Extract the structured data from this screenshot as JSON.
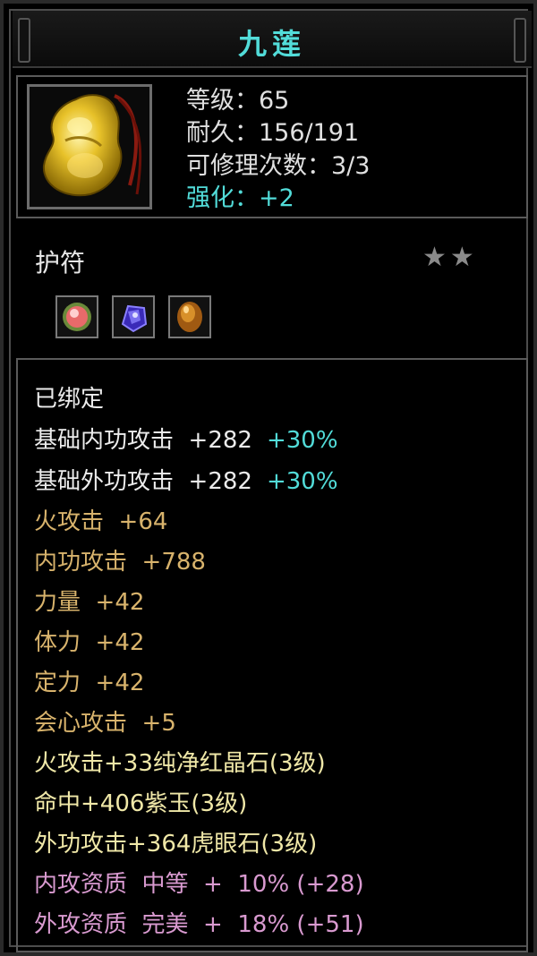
{
  "item": {
    "name": "九莲",
    "icon": "jade-pendant-icon",
    "stats": {
      "level": "等级：65",
      "durability": "耐久：156/191",
      "repairs": "可修理次数：3/3",
      "enhance": "强化：+2"
    },
    "type": "护符",
    "stars": "★★",
    "star_count": 2,
    "sockets": [
      {
        "icon": "red-crystal-gem-icon"
      },
      {
        "icon": "purple-jade-gem-icon"
      },
      {
        "icon": "tiger-eye-gem-icon"
      }
    ]
  },
  "attributes": {
    "bound": "已绑定",
    "base_inner_attack": {
      "label": "基础内功攻击  +282",
      "bonus": "+30%"
    },
    "base_outer_attack": {
      "label": "基础外功攻击  +282",
      "bonus": "+30%"
    },
    "fire_attack": "火攻击  +64",
    "inner_attack": "内功攻击  +788",
    "strength": "力量  +42",
    "constitution": "体力  +42",
    "focus": "定力  +42",
    "critical": "会心攻击  +5",
    "gem_1": "火攻击+33纯净红晶石(3级)",
    "gem_2": "命中+406紫玉(3级)",
    "gem_3": "外功攻击+364虎眼石(3级)",
    "quality_inner": "内攻资质  中等  +  10% (+28)",
    "quality_outer": "外攻资质  完美  +  18% (+51)"
  },
  "colors": {
    "title": "#52dcd9",
    "accent": "#52dcd9",
    "tan": "#d8b36c",
    "gem_text": "#f0e8a8",
    "quality": "#d99ad0"
  }
}
